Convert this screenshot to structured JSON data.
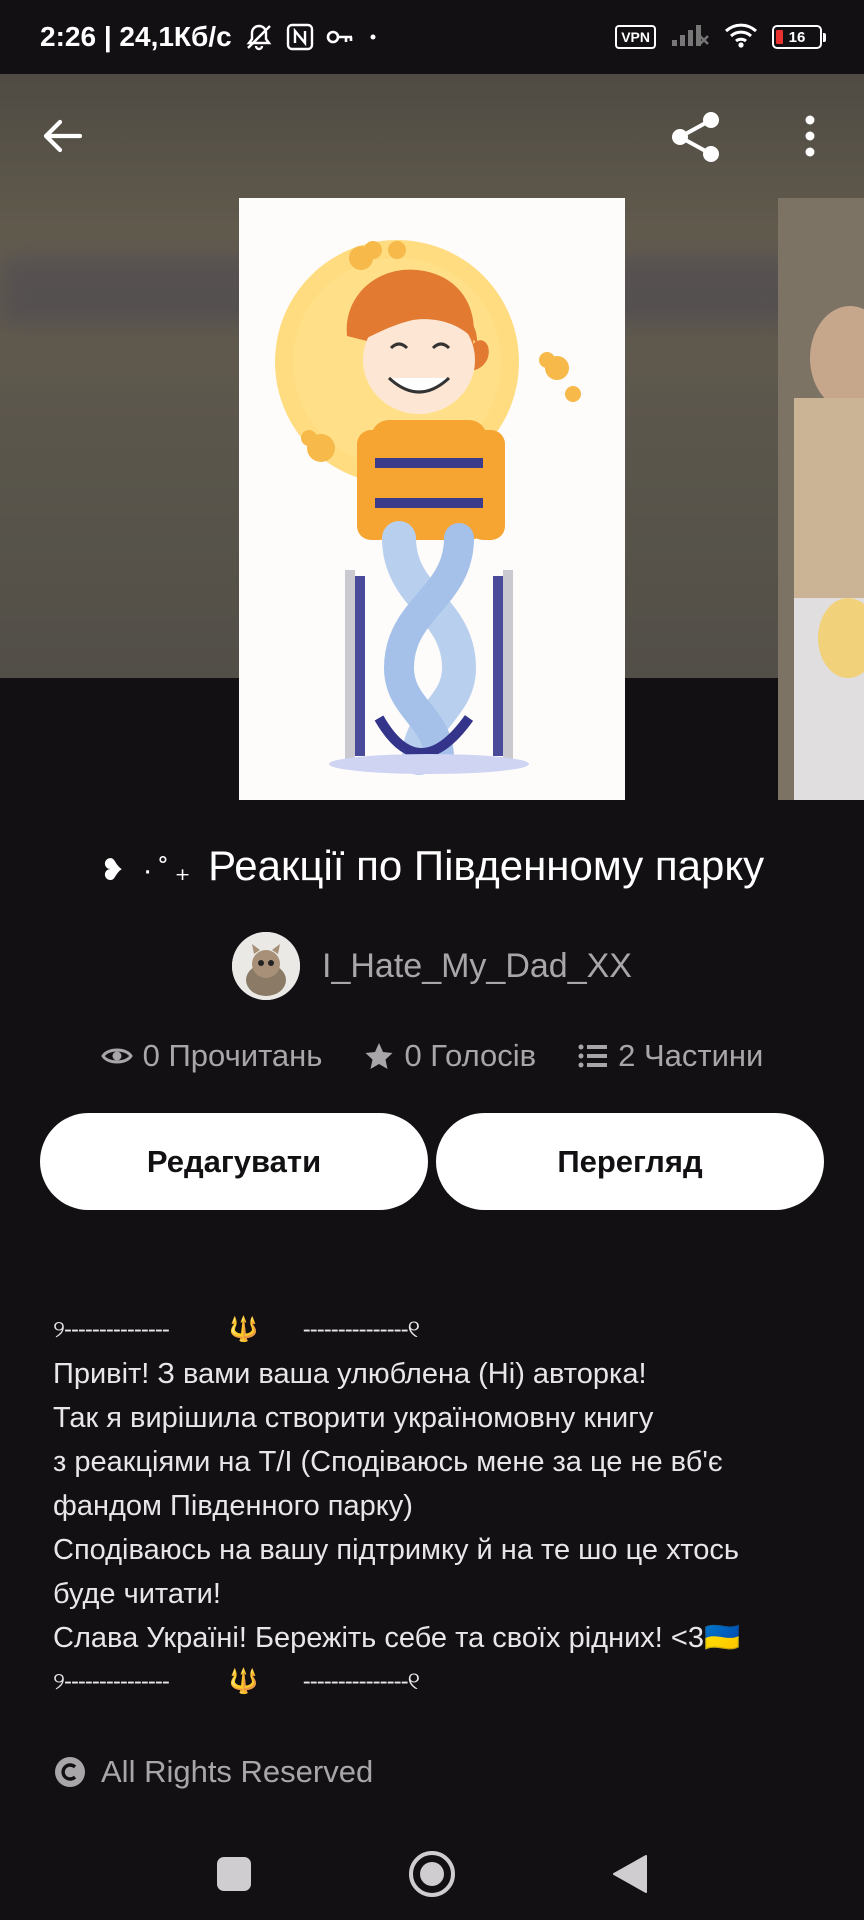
{
  "status_bar": {
    "time_speed": "2:26 | 24,1Кб/с",
    "vpn": "VPN",
    "battery": "16",
    "battery_level": 0.16
  },
  "story": {
    "title": "Реакції по Південному парку",
    "title_prefix": "·˚₊",
    "author": "I_Hate_My_Dad_XX",
    "stats": {
      "reads": "0 Прочитань",
      "votes": "0 Голосів",
      "parts": "2 Частини"
    }
  },
  "buttons": {
    "edit": "Редагувати",
    "view": "Перегляд"
  },
  "description": {
    "divider_left": "୨---------------",
    "divider_right": "---------------୧",
    "trident": "🔱",
    "lines": [
      "Привіт! З вами ваша улюблена (Ні) авторка!",
      "Так я вирішила створити україномовну книгу",
      "з реакціями на Т/І (Сподіваюсь мене за це не вб'є",
      "фандом Південного парку)",
      "Сподіваюсь на вашу підтримку й на те шо це хтось",
      "буде читати!",
      "Слава Україні! Бережіть себе та своїх рідних! <3"
    ],
    "flag": "🇺🇦"
  },
  "rights": "All Rights Reserved",
  "icons": {
    "back": "arrow-left-icon",
    "share": "share-icon",
    "more": "more-vertical-icon",
    "reads": "eye-icon",
    "votes": "star-icon",
    "parts": "list-icon",
    "copyright": "copyright-icon"
  },
  "colors": {
    "background": "#121013",
    "button_bg": "#ffffff",
    "muted_text": "#a8a6a8",
    "trident": "#f0b400"
  }
}
